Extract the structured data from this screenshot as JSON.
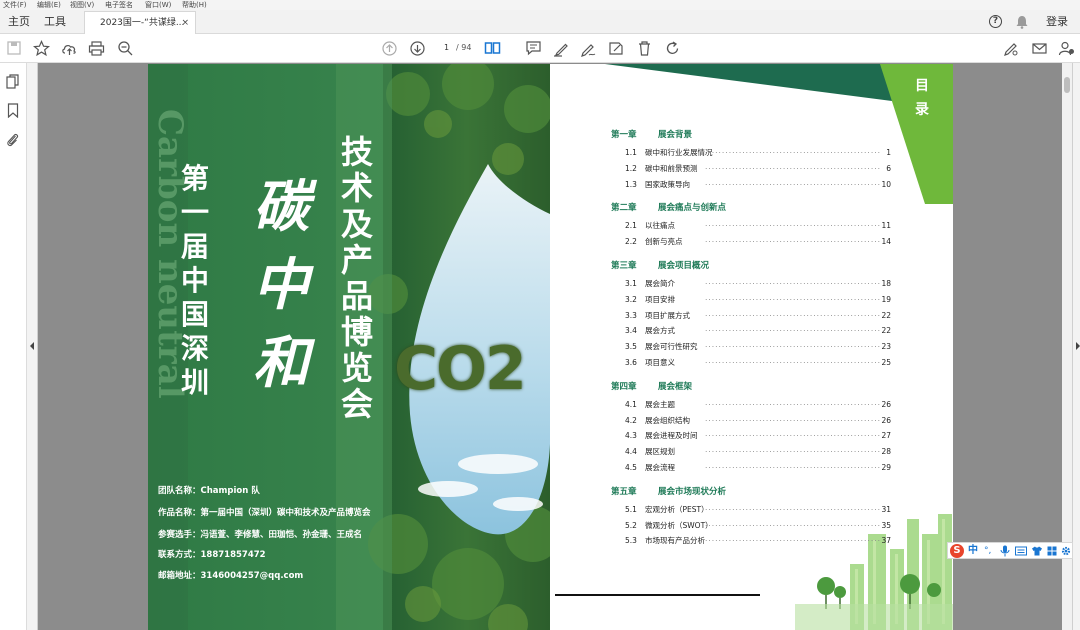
{
  "menu": [
    "文件(F)",
    "编辑(E)",
    "视图(V)",
    "电子签名",
    "窗口(W)",
    "帮助(H)"
  ],
  "tabs": {
    "home": "主页",
    "tools": "工具",
    "document": "2023国一-“共谋绿...",
    "close": "×"
  },
  "header_right": {
    "help_icon": "help-icon",
    "bell_icon": "bell-icon",
    "login": "登录"
  },
  "toolbar": {
    "page_current": "1",
    "page_total": "/ 94"
  },
  "cover": {
    "left_title": "第一届中国深圳",
    "main_title": "碳中和",
    "right_title": "技术及产品博览会",
    "co2": "CO2",
    "watermark": "Carbon neutral",
    "info": [
      {
        "label": "团队名称：",
        "value": "Champion 队"
      },
      {
        "label": "作品名称：",
        "value": "第一届中国（深圳）碳中和技术及产品博览会"
      },
      {
        "label": "参赛选手：",
        "value": "冯语萱、李修慧、田珈恺、孙金珊、王成名"
      },
      {
        "label": "联系方式：",
        "value": "18871857472"
      },
      {
        "label": "邮箱地址：",
        "value": "3146004257@qq.com"
      }
    ]
  },
  "toc": {
    "heading": "目录",
    "chapters": [
      {
        "label": "第一章",
        "title": "展会背景",
        "items": [
          {
            "num": "1.1",
            "title": "碳中和行业发展情况",
            "page": "1"
          },
          {
            "num": "1.2",
            "title": "碳中和前景预测",
            "page": "6"
          },
          {
            "num": "1.3",
            "title": "国家政策导向",
            "page": "10"
          }
        ]
      },
      {
        "label": "第二章",
        "title": "展会痛点与创新点",
        "items": [
          {
            "num": "2.1",
            "title": "以往痛点",
            "page": "11"
          },
          {
            "num": "2.2",
            "title": "创新与亮点",
            "page": "14"
          }
        ]
      },
      {
        "label": "第三章",
        "title": "展会项目概况",
        "items": [
          {
            "num": "3.1",
            "title": "展会简介",
            "page": "18"
          },
          {
            "num": "3.2",
            "title": "项目安排",
            "page": "19"
          },
          {
            "num": "3.3",
            "title": "项目扩展方式",
            "page": "22"
          },
          {
            "num": "3.4",
            "title": "展会方式",
            "page": "22"
          },
          {
            "num": "3.5",
            "title": "展会可行性研究",
            "page": "23"
          },
          {
            "num": "3.6",
            "title": "项目意义",
            "page": "25"
          }
        ]
      },
      {
        "label": "第四章",
        "title": "展会框架",
        "items": [
          {
            "num": "4.1",
            "title": "展会主题",
            "page": "26"
          },
          {
            "num": "4.2",
            "title": "展会组织结构",
            "page": "26"
          },
          {
            "num": "4.3",
            "title": "展会进程及时间",
            "page": "27"
          },
          {
            "num": "4.4",
            "title": "展区规划",
            "page": "28"
          },
          {
            "num": "4.5",
            "title": "展会流程",
            "page": "29"
          }
        ]
      },
      {
        "label": "第五章",
        "title": "展会市场现状分析",
        "items": [
          {
            "num": "5.1",
            "title": "宏观分析（PEST）",
            "page": "31"
          },
          {
            "num": "5.2",
            "title": "微观分析（SWOT）",
            "page": "35"
          },
          {
            "num": "5.3",
            "title": "市场现有产品分析",
            "page": "37"
          }
        ]
      }
    ]
  },
  "ime": {
    "logo": "S",
    "mode": "中"
  },
  "colors": {
    "accent_green": "#1e7a57",
    "lime": "#6fb83b",
    "cover_green": "#3e8a52"
  }
}
